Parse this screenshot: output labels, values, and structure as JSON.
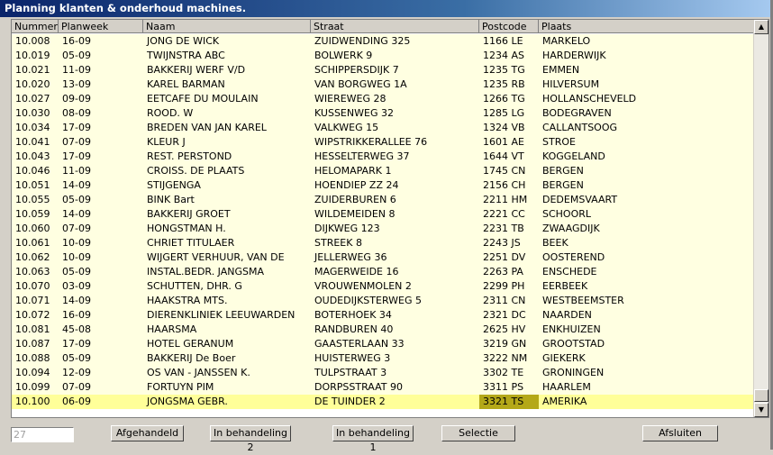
{
  "window": {
    "title": "Planning klanten & onderhoud machines."
  },
  "columns": [
    "Nummer",
    "Planweek",
    "Naam",
    "Straat",
    "Postcode",
    "Plaats"
  ],
  "rows": [
    [
      "10.008",
      "16-09",
      "JONG DE  WICK",
      "ZUIDWENDING 325",
      "1166 LE",
      "MARKELO"
    ],
    [
      "10.019",
      "05-09",
      "TWIJNSTRA ABC",
      "BOLWERK 9",
      "1234 AS",
      "HARDERWIJK"
    ],
    [
      "10.021",
      "11-09",
      "BAKKERIJ WERF V/D",
      "SCHIPPERSDIJK 7",
      "1235 TG",
      "EMMEN"
    ],
    [
      "10.020",
      "13-09",
      "KAREL BARMAN",
      "VAN BORGWEG 1A",
      "1235 RB",
      "HILVERSUM"
    ],
    [
      "10.027",
      "09-09",
      "EETCAFE DU MOULAIN",
      "WIEREWEG 28",
      "1266 TG",
      "HOLLANSCHEVELD"
    ],
    [
      "10.030",
      "08-09",
      "ROOD. W",
      "KUSSENWEG 32",
      "1285 LG",
      "BODEGRAVEN"
    ],
    [
      "10.034",
      "17-09",
      "BREDEN VAN JAN KAREL",
      "VALKWEG 15",
      "1324 VB",
      "CALLANTSOOG"
    ],
    [
      "10.041",
      "07-09",
      "KLEUR J",
      "WIPSTRIKKERALLEE 76",
      "1601 AE",
      "STROE"
    ],
    [
      "10.043",
      "17-09",
      "REST. PERSTOND",
      "HESSELTERWEG 37",
      "1644 VT",
      "KOGGELAND"
    ],
    [
      "10.046",
      "11-09",
      "CROISS. DE PLAATS",
      "HELOMAPARK 1",
      "1745 CN",
      "BERGEN"
    ],
    [
      "10.051",
      "14-09",
      "STIJGENGA",
      "HOENDIEP ZZ 24",
      "2156 CH",
      "BERGEN"
    ],
    [
      "10.055",
      "05-09",
      "BINK Bart",
      "ZUIDERBUREN 6",
      "2211 HM",
      "DEDEMSVAART"
    ],
    [
      "10.059",
      "14-09",
      "BAKKERIJ GROET",
      "WILDEMEIDEN 8",
      "2221 CC",
      "SCHOORL"
    ],
    [
      "10.060",
      "07-09",
      "HONGSTMAN H.",
      "DIJKWEG 123",
      "2231 TB",
      "ZWAAGDIJK"
    ],
    [
      "10.061",
      "10-09",
      "CHRIET TITULAER",
      "STREEK 8",
      "2243 JS",
      "BEEK"
    ],
    [
      "10.062",
      "10-09",
      "WIJGERT VERHUUR, VAN DE",
      "JELLERWEG 36",
      "2251 DV",
      "OOSTEREND"
    ],
    [
      "10.063",
      "05-09",
      "INSTAL.BEDR. JANGSMA",
      "MAGERWEIDE 16",
      "2263 PA",
      "ENSCHEDE"
    ],
    [
      "10.070",
      "03-09",
      "SCHUTTEN, DHR. G",
      "VROUWENMOLEN 2",
      "2299 PH",
      "EERBEEK"
    ],
    [
      "10.071",
      "14-09",
      "HAAKSTRA MTS.",
      "OUDEDIJKSTERWEG 5",
      "2311 CN",
      "WESTBEEMSTER"
    ],
    [
      "10.072",
      "16-09",
      "DIERENKLINIEK LEEUWARDEN",
      "BOTERHOEK 34",
      "2321 DC",
      "NAARDEN"
    ],
    [
      "10.081",
      "45-08",
      "HAARSMA",
      "RANDBUREN 40",
      "2625 HV",
      "ENKHUIZEN"
    ],
    [
      "10.087",
      "17-09",
      "HOTEL GERANUM",
      "GAASTERLAAN 33",
      "3219 GN",
      "GROOTSTAD"
    ],
    [
      "10.088",
      "05-09",
      "BAKKERIJ De Boer",
      "HUISTERWEG 3",
      "3222 NM",
      "GIEKERK"
    ],
    [
      "10.094",
      "12-09",
      "OS VAN - JANSSEN K.",
      "TULPSTRAAT 3",
      "3302 TE",
      "GRONINGEN"
    ],
    [
      "10.099",
      "07-09",
      "FORTUYN PIM",
      "DORPSSTRAAT 90",
      "3311 PS",
      "HAARLEM"
    ],
    [
      "10.100",
      "06-09",
      "JONGSMA GEBR.",
      "DE TUINDER 2",
      "3321 TS",
      "AMERIKA"
    ]
  ],
  "selected_row_index": 25,
  "footer": {
    "count_value": "27",
    "buttons": [
      "Afgehandeld",
      "In behandeling 2",
      "In behandeling 1",
      "Selectie",
      "Afsluiten"
    ]
  },
  "colors": {
    "row_bg": "#ffffe1",
    "selected_row_bg": "#ffff99",
    "selected_cell_bg": "#b4a818",
    "title_bar": "#0a246a"
  }
}
